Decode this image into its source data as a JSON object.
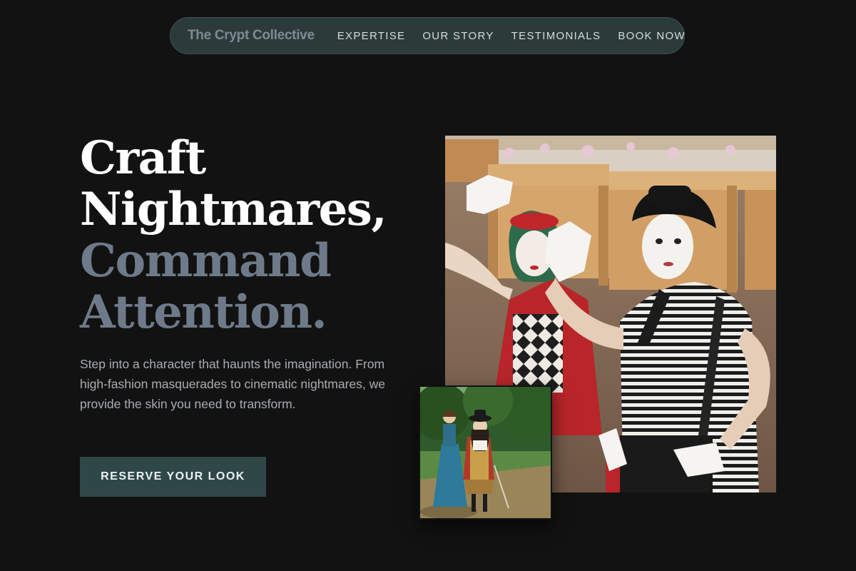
{
  "nav": {
    "brand": "The Crypt Collective",
    "links": [
      "EXPERTISE",
      "OUR STORY",
      "TESTIMONIALS",
      "BOOK NOW"
    ]
  },
  "hero": {
    "headline": {
      "line1": "Craft",
      "line2": "Nightmares,",
      "line3": "Command",
      "line4": "Attention."
    },
    "subcopy": "Step into a character that haunts the imagination. From high-fashion masquerades to cinematic nightmares, we provide the skin you need to transform.",
    "cta_label": "RESERVE YOUR LOOK"
  },
  "images": {
    "main": "mimes-street-photo",
    "secondary": "period-costume-couple-photo"
  },
  "colors": {
    "background": "#121212",
    "nav_background": "#2b3b3a",
    "accent": "#2f4847",
    "headline_muted": "#6e7a8a"
  }
}
